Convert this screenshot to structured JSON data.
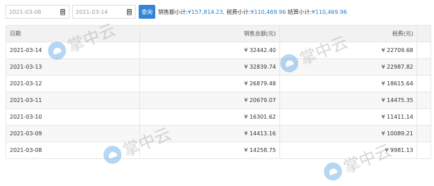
{
  "filters": {
    "start_date": "2021-03-08",
    "end_date": "2021-03-14",
    "query_label": "查询"
  },
  "summary": {
    "sales_label": "销售额小计:",
    "sales_value": "¥157,814.23,",
    "tax_label": "税费小计:",
    "tax_value": "¥110,469.96",
    "settle_label": "结算小计:",
    "settle_value": "¥110,469.96"
  },
  "table": {
    "headers": [
      "日期",
      "销售总额(元)",
      "税费(元)"
    ],
    "rows": [
      {
        "date": "2021-03-14",
        "sales": "¥ 32442.40",
        "tax": "¥ 22709.68"
      },
      {
        "date": "2021-03-13",
        "sales": "¥ 32839.74",
        "tax": "¥ 22987.82"
      },
      {
        "date": "2021-03-12",
        "sales": "¥ 26879.48",
        "tax": "¥ 18615.64"
      },
      {
        "date": "2021-03-11",
        "sales": "¥ 20679.07",
        "tax": "¥ 14475.35"
      },
      {
        "date": "2021-03-10",
        "sales": "¥ 16301.62",
        "tax": "¥ 11411.14"
      },
      {
        "date": "2021-03-09",
        "sales": "¥ 14413.16",
        "tax": "¥ 10089.21"
      },
      {
        "date": "2021-03-08",
        "sales": "¥ 14258.75",
        "tax": "¥ 9981.13"
      }
    ]
  },
  "watermark": {
    "text": "掌中云",
    "color": "#2f8fe0"
  },
  "colors": {
    "accent": "#3385d6",
    "amount": "#2d7cc5"
  }
}
